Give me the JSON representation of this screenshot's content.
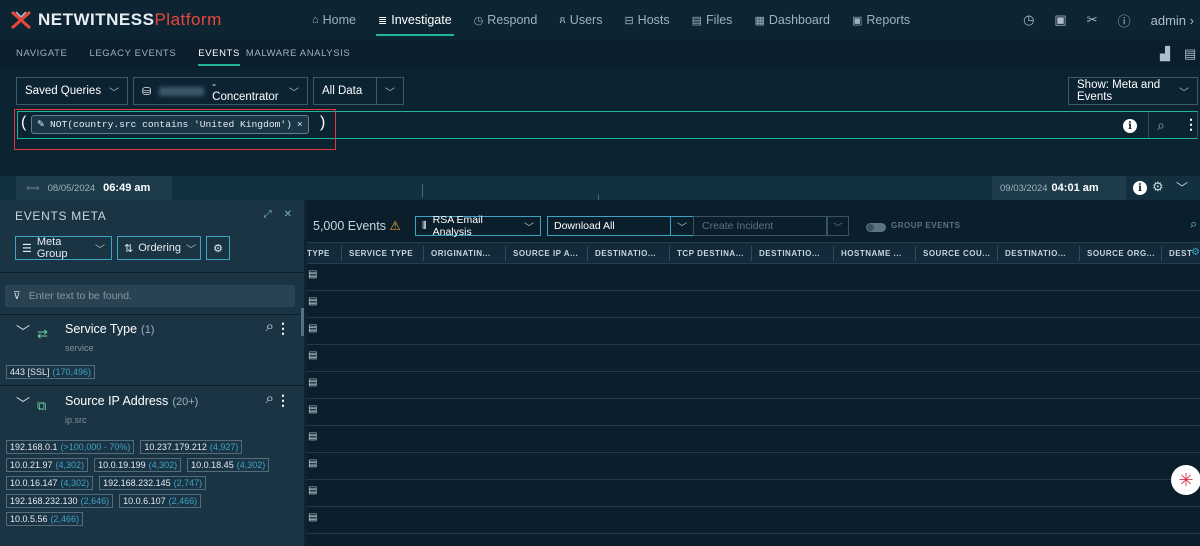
{
  "app": {
    "brand": "NETWITNESS",
    "brand_suffix": "Platform",
    "accent": "#21b59c",
    "brand_red": "#e8473c"
  },
  "nav": [
    {
      "icon": "home-icon",
      "glyph": "⌂",
      "label": "Home"
    },
    {
      "icon": "investigate-icon",
      "glyph": "≣",
      "label": "Investigate",
      "active": true
    },
    {
      "icon": "respond-icon",
      "glyph": "◷",
      "label": "Respond"
    },
    {
      "icon": "users-icon",
      "glyph": "ጸ",
      "label": "Users"
    },
    {
      "icon": "hosts-icon",
      "glyph": "⊟",
      "label": "Hosts"
    },
    {
      "icon": "files-icon",
      "glyph": "▤",
      "label": "Files"
    },
    {
      "icon": "dashboard-icon",
      "glyph": "▦",
      "label": "Dashboard"
    },
    {
      "icon": "reports-icon",
      "glyph": "▣",
      "label": "Reports"
    }
  ],
  "user": {
    "label": "admin"
  },
  "subnav": {
    "tabs": [
      "NAVIGATE",
      "LEGACY EVENTS",
      "EVENTS",
      "MALWARE ANALYSIS"
    ],
    "active": "EVENTS"
  },
  "query": {
    "saved_queries": "Saved Queries",
    "service_suffix": "- Concentrator",
    "data_range": "All Data",
    "show_meta": "Show: Meta and Events",
    "filter_pill": "NOT(country.src contains 'United Kingdom')",
    "open_paren": "(",
    "close_paren": ")"
  },
  "timeline": {
    "start_date": "08/05/2024",
    "start_time": "06:49 am",
    "end_date": "09/03/2024",
    "end_time": "04:01 am"
  },
  "meta_panel": {
    "title": "EVENTS META",
    "meta_group_btn": "Meta Group",
    "ordering_btn": "Ordering",
    "search_placeholder": "Enter text to be found.",
    "groups": [
      {
        "name": "Service Type",
        "count": "(1)",
        "key": "service",
        "values": [
          {
            "v": "443 [SSL]",
            "c": "(170,496)"
          }
        ]
      },
      {
        "name": "Source IP Address",
        "count": "(20+)",
        "key": "ip.src",
        "values": [
          {
            "v": "192.168.0.1",
            "c": "(>100,000 - 70%)"
          },
          {
            "v": "10.237.179.212",
            "c": "(4,927)"
          },
          {
            "v": "10.0.21.97",
            "c": "(4,302)"
          },
          {
            "v": "10.0.19.199",
            "c": "(4,302)"
          },
          {
            "v": "10.0.18.45",
            "c": "(4,302)"
          },
          {
            "v": "10.0.16.147",
            "c": "(4,302)"
          },
          {
            "v": "192.168.232.145",
            "c": "(2,747)"
          },
          {
            "v": "192.168.232.130",
            "c": "(2,646)"
          },
          {
            "v": "10.0.6.107",
            "c": "(2,466)"
          },
          {
            "v": "10.0.5.56",
            "c": "(2,466)"
          }
        ]
      }
    ]
  },
  "events": {
    "count": "5,000 Events",
    "email_analysis": "RSA Email Analysis",
    "download": "Download All",
    "create_incident": "Create Incident",
    "group_events": "GROUP EVENTS",
    "columns": [
      "TYPE",
      "SERVICE TYPE",
      "ORIGINATIN...",
      "SOURCE IP A...",
      "DESTINATIO...",
      "TCP DESTINA...",
      "DESTINATIO...",
      "HOSTNAME ...",
      "SOURCE COU...",
      "DESTINATIO...",
      "SOURCE ORG...",
      "DEST"
    ],
    "row_count": 10
  }
}
